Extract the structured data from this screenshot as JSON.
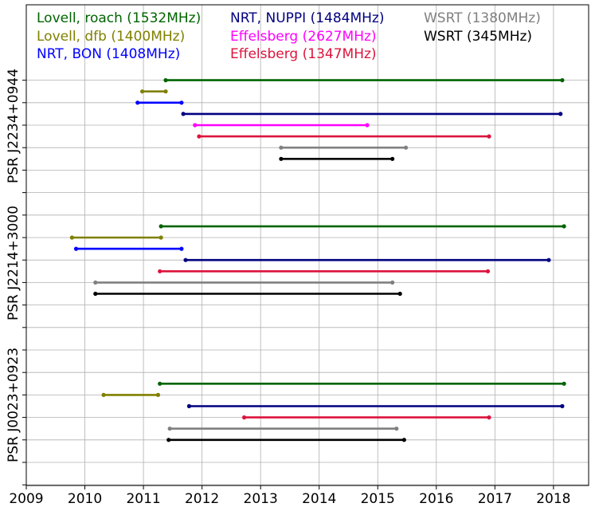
{
  "chart_data": {
    "type": "timeline",
    "title": "",
    "xlabel": "",
    "ylabel": "",
    "xlim": [
      2009,
      2018.6
    ],
    "grid": true,
    "x_ticks": [
      2009,
      2010,
      2011,
      2012,
      2013,
      2014,
      2015,
      2016,
      2017,
      2018
    ],
    "legend": {
      "placement": "top",
      "entries": [
        {
          "label": "Lovell, roach (1532MHz)",
          "color": "#006400"
        },
        {
          "label": "Lovell, dfb (1400MHz)",
          "color": "#808000"
        },
        {
          "label": "NRT, BON (1408MHz)",
          "color": "#0000ff"
        },
        {
          "label": "NRT, NUPPI (1484MHz)",
          "color": "#000080"
        },
        {
          "label": "Effelsberg (2627MHz)",
          "color": "#ff00ff"
        },
        {
          "label": "Effelsberg (1347MHz)",
          "color": "#dc143c"
        },
        {
          "label": "WSRT (1380MHz)",
          "color": "#808080"
        },
        {
          "label": "WSRT (345MHz)",
          "color": "#000000"
        }
      ]
    },
    "groups": [
      {
        "name": "PSR J2234+0944",
        "spans": [
          {
            "series": "Lovell, roach (1532MHz)",
            "start": 2011.38,
            "end": 2018.15
          },
          {
            "series": "Lovell, dfb (1400MHz)",
            "start": 2010.98,
            "end": 2011.38
          },
          {
            "series": "NRT, BON (1408MHz)",
            "start": 2010.9,
            "end": 2011.65
          },
          {
            "series": "NRT, NUPPI (1484MHz)",
            "start": 2011.68,
            "end": 2018.12
          },
          {
            "series": "Effelsberg (2627MHz)",
            "start": 2011.88,
            "end": 2014.82
          },
          {
            "series": "Effelsberg (1347MHz)",
            "start": 2011.95,
            "end": 2016.9
          },
          {
            "series": "WSRT (1380MHz)",
            "start": 2013.35,
            "end": 2015.48
          },
          {
            "series": "WSRT (345MHz)",
            "start": 2013.35,
            "end": 2015.25
          }
        ]
      },
      {
        "name": "PSR J2214+3000",
        "spans": [
          {
            "series": "Lovell, roach (1532MHz)",
            "start": 2011.3,
            "end": 2018.18
          },
          {
            "series": "Lovell, dfb (1400MHz)",
            "start": 2009.78,
            "end": 2011.3
          },
          {
            "series": "NRT, BON (1408MHz)",
            "start": 2009.85,
            "end": 2011.65
          },
          {
            "series": "NRT, NUPPI (1484MHz)",
            "start": 2011.72,
            "end": 2017.92
          },
          {
            "series": "Effelsberg (1347MHz)",
            "start": 2011.28,
            "end": 2016.88
          },
          {
            "series": "WSRT (1380MHz)",
            "start": 2010.18,
            "end": 2015.25
          },
          {
            "series": "WSRT (345MHz)",
            "start": 2010.18,
            "end": 2015.38
          }
        ]
      },
      {
        "name": "PSR J0023+0923",
        "spans": [
          {
            "series": "Lovell, roach (1532MHz)",
            "start": 2011.28,
            "end": 2018.18
          },
          {
            "series": "Lovell, dfb (1400MHz)",
            "start": 2010.32,
            "end": 2011.25
          },
          {
            "series": "NRT, NUPPI (1484MHz)",
            "start": 2011.78,
            "end": 2018.15
          },
          {
            "series": "Effelsberg (1347MHz)",
            "start": 2012.72,
            "end": 2016.9
          },
          {
            "series": "WSRT (1380MHz)",
            "start": 2011.45,
            "end": 2015.32
          },
          {
            "series": "WSRT (345MHz)",
            "start": 2011.43,
            "end": 2015.45
          }
        ]
      }
    ]
  }
}
